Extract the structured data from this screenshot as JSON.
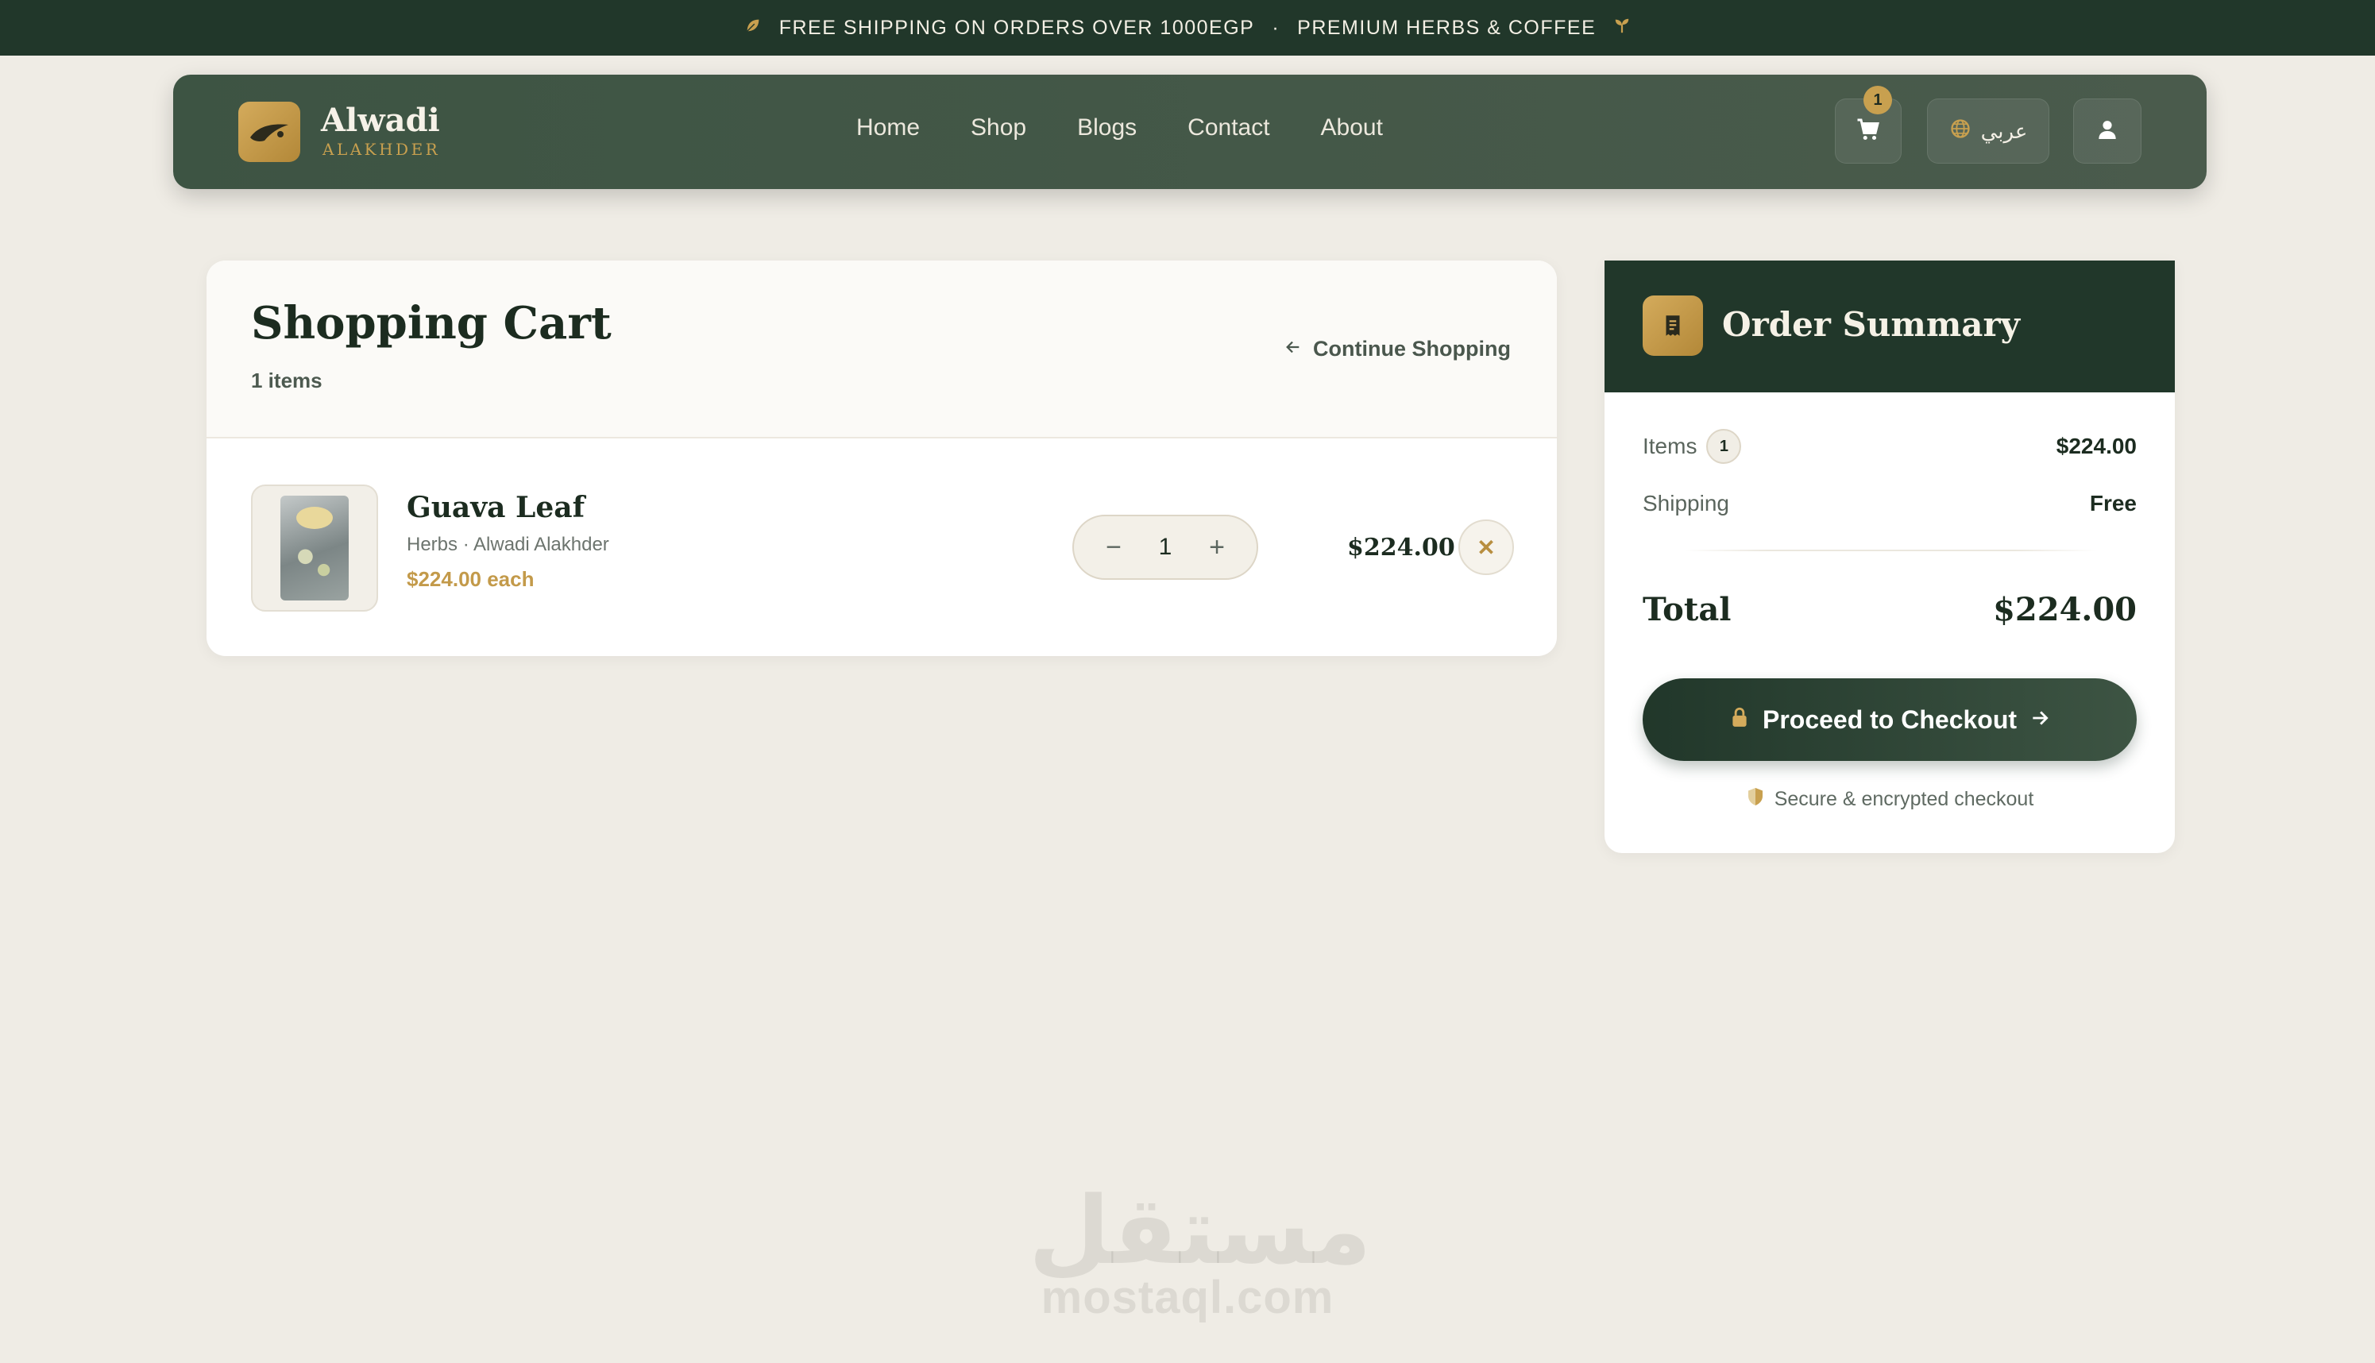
{
  "announcement": {
    "text": "FREE SHIPPING ON ORDERS OVER 1000EGP",
    "separator": "·",
    "text2": "PREMIUM HERBS & COFFEE"
  },
  "header": {
    "brand_name": "Alwadi",
    "brand_sub": "ALAKHDER",
    "nav": [
      "Home",
      "Shop",
      "Blogs",
      "Contact",
      "About"
    ],
    "cart_count": "1",
    "language_label": "عربي"
  },
  "cart": {
    "title": "Shopping Cart",
    "count_text": "1 items",
    "continue_label": "Continue Shopping",
    "items": [
      {
        "name": "Guava Leaf",
        "meta": "Herbs · Alwadi Alakhder",
        "each": "$224.00 each",
        "quantity": "1",
        "price": "$224.00",
        "minus": "−",
        "plus": "+",
        "remove": "✕"
      }
    ]
  },
  "summary": {
    "title": "Order Summary",
    "items_label": "Items",
    "items_count": "1",
    "items_value": "$224.00",
    "shipping_label": "Shipping",
    "shipping_value": "Free",
    "total_label": "Total",
    "total_value": "$224.00",
    "checkout_label": "Proceed to Checkout",
    "secure_text": "Secure & encrypted checkout"
  },
  "watermark": {
    "arabic": "مستقل",
    "latin": "mostaql.com"
  },
  "colors": {
    "primary": "#21372a",
    "accent": "#c8a04f",
    "background": "#efece5"
  }
}
